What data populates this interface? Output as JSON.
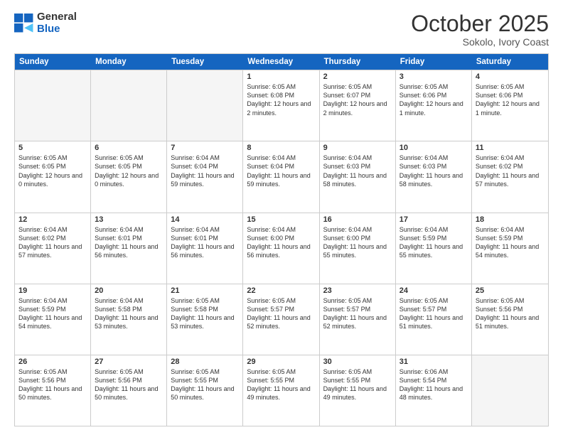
{
  "logo": {
    "general": "General",
    "blue": "Blue"
  },
  "header": {
    "month": "October 2025",
    "location": "Sokolo, Ivory Coast"
  },
  "days": [
    "Sunday",
    "Monday",
    "Tuesday",
    "Wednesday",
    "Thursday",
    "Friday",
    "Saturday"
  ],
  "rows": [
    [
      {
        "day": "",
        "text": ""
      },
      {
        "day": "",
        "text": ""
      },
      {
        "day": "",
        "text": ""
      },
      {
        "day": "1",
        "text": "Sunrise: 6:05 AM\nSunset: 6:08 PM\nDaylight: 12 hours and 2 minutes."
      },
      {
        "day": "2",
        "text": "Sunrise: 6:05 AM\nSunset: 6:07 PM\nDaylight: 12 hours and 2 minutes."
      },
      {
        "day": "3",
        "text": "Sunrise: 6:05 AM\nSunset: 6:06 PM\nDaylight: 12 hours and 1 minute."
      },
      {
        "day": "4",
        "text": "Sunrise: 6:05 AM\nSunset: 6:06 PM\nDaylight: 12 hours and 1 minute."
      }
    ],
    [
      {
        "day": "5",
        "text": "Sunrise: 6:05 AM\nSunset: 6:05 PM\nDaylight: 12 hours and 0 minutes."
      },
      {
        "day": "6",
        "text": "Sunrise: 6:05 AM\nSunset: 6:05 PM\nDaylight: 12 hours and 0 minutes."
      },
      {
        "day": "7",
        "text": "Sunrise: 6:04 AM\nSunset: 6:04 PM\nDaylight: 11 hours and 59 minutes."
      },
      {
        "day": "8",
        "text": "Sunrise: 6:04 AM\nSunset: 6:04 PM\nDaylight: 11 hours and 59 minutes."
      },
      {
        "day": "9",
        "text": "Sunrise: 6:04 AM\nSunset: 6:03 PM\nDaylight: 11 hours and 58 minutes."
      },
      {
        "day": "10",
        "text": "Sunrise: 6:04 AM\nSunset: 6:03 PM\nDaylight: 11 hours and 58 minutes."
      },
      {
        "day": "11",
        "text": "Sunrise: 6:04 AM\nSunset: 6:02 PM\nDaylight: 11 hours and 57 minutes."
      }
    ],
    [
      {
        "day": "12",
        "text": "Sunrise: 6:04 AM\nSunset: 6:02 PM\nDaylight: 11 hours and 57 minutes."
      },
      {
        "day": "13",
        "text": "Sunrise: 6:04 AM\nSunset: 6:01 PM\nDaylight: 11 hours and 56 minutes."
      },
      {
        "day": "14",
        "text": "Sunrise: 6:04 AM\nSunset: 6:01 PM\nDaylight: 11 hours and 56 minutes."
      },
      {
        "day": "15",
        "text": "Sunrise: 6:04 AM\nSunset: 6:00 PM\nDaylight: 11 hours and 56 minutes."
      },
      {
        "day": "16",
        "text": "Sunrise: 6:04 AM\nSunset: 6:00 PM\nDaylight: 11 hours and 55 minutes."
      },
      {
        "day": "17",
        "text": "Sunrise: 6:04 AM\nSunset: 5:59 PM\nDaylight: 11 hours and 55 minutes."
      },
      {
        "day": "18",
        "text": "Sunrise: 6:04 AM\nSunset: 5:59 PM\nDaylight: 11 hours and 54 minutes."
      }
    ],
    [
      {
        "day": "19",
        "text": "Sunrise: 6:04 AM\nSunset: 5:59 PM\nDaylight: 11 hours and 54 minutes."
      },
      {
        "day": "20",
        "text": "Sunrise: 6:04 AM\nSunset: 5:58 PM\nDaylight: 11 hours and 53 minutes."
      },
      {
        "day": "21",
        "text": "Sunrise: 6:05 AM\nSunset: 5:58 PM\nDaylight: 11 hours and 53 minutes."
      },
      {
        "day": "22",
        "text": "Sunrise: 6:05 AM\nSunset: 5:57 PM\nDaylight: 11 hours and 52 minutes."
      },
      {
        "day": "23",
        "text": "Sunrise: 6:05 AM\nSunset: 5:57 PM\nDaylight: 11 hours and 52 minutes."
      },
      {
        "day": "24",
        "text": "Sunrise: 6:05 AM\nSunset: 5:57 PM\nDaylight: 11 hours and 51 minutes."
      },
      {
        "day": "25",
        "text": "Sunrise: 6:05 AM\nSunset: 5:56 PM\nDaylight: 11 hours and 51 minutes."
      }
    ],
    [
      {
        "day": "26",
        "text": "Sunrise: 6:05 AM\nSunset: 5:56 PM\nDaylight: 11 hours and 50 minutes."
      },
      {
        "day": "27",
        "text": "Sunrise: 6:05 AM\nSunset: 5:56 PM\nDaylight: 11 hours and 50 minutes."
      },
      {
        "day": "28",
        "text": "Sunrise: 6:05 AM\nSunset: 5:55 PM\nDaylight: 11 hours and 50 minutes."
      },
      {
        "day": "29",
        "text": "Sunrise: 6:05 AM\nSunset: 5:55 PM\nDaylight: 11 hours and 49 minutes."
      },
      {
        "day": "30",
        "text": "Sunrise: 6:05 AM\nSunset: 5:55 PM\nDaylight: 11 hours and 49 minutes."
      },
      {
        "day": "31",
        "text": "Sunrise: 6:06 AM\nSunset: 5:54 PM\nDaylight: 11 hours and 48 minutes."
      },
      {
        "day": "",
        "text": ""
      }
    ]
  ]
}
